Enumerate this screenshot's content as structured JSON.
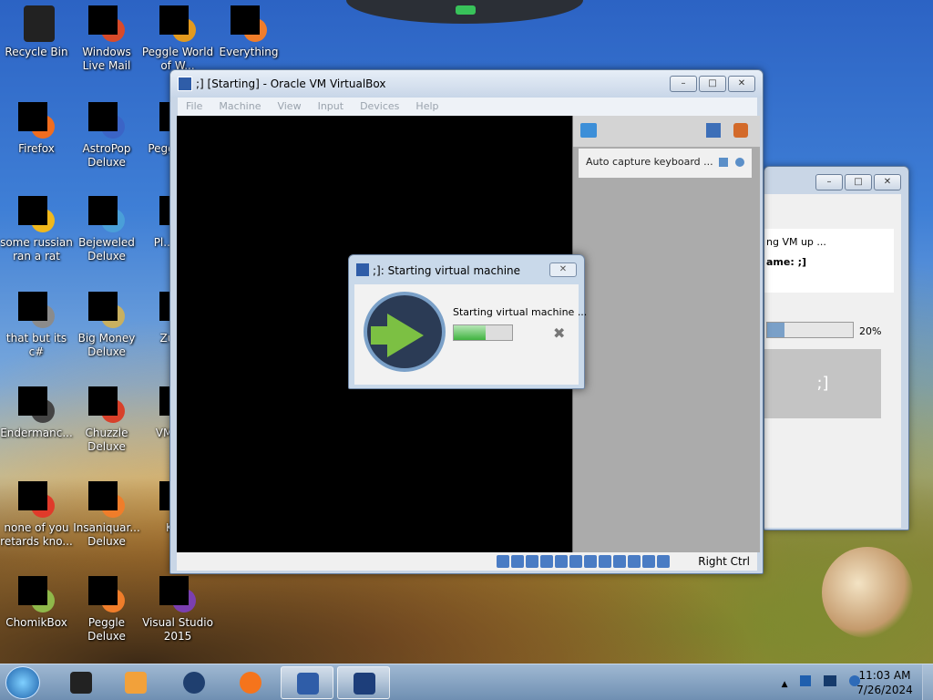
{
  "desktop_icons": [
    {
      "label": "Recycle Bin",
      "icon": "recycle-bin-icon"
    },
    {
      "label": "Windows Live Mail",
      "icon": "mail-icon"
    },
    {
      "label": "Peggle World of W...",
      "icon": "peggle-icon"
    },
    {
      "label": "Everything",
      "icon": "everything-icon"
    },
    {
      "label": "Firefox",
      "icon": "firefox-icon"
    },
    {
      "label": "AstroPop Deluxe",
      "icon": "game-icon"
    },
    {
      "label": "Pegg... D...",
      "icon": "game-icon"
    },
    {
      "label": "some russian ran a rat",
      "icon": "app-icon"
    },
    {
      "label": "Bejeweled Deluxe",
      "icon": "game-icon"
    },
    {
      "label": "Pl... Zo...",
      "icon": "game-icon"
    },
    {
      "label": "that but its c#",
      "icon": "app-icon"
    },
    {
      "label": "Big Money Deluxe",
      "icon": "game-icon"
    },
    {
      "label": "Zum...",
      "icon": "game-icon"
    },
    {
      "label": "Endermanc...",
      "icon": "app-icon"
    },
    {
      "label": "Chuzzle Deluxe",
      "icon": "game-icon"
    },
    {
      "label": "VM Ke...",
      "icon": "app-icon"
    },
    {
      "label": "none of you retards kno...",
      "icon": "app-icon"
    },
    {
      "label": "Insaniquar... Deluxe",
      "icon": "game-icon"
    },
    {
      "label": "Ke...",
      "icon": "app-icon"
    },
    {
      "label": "ChomikBox",
      "icon": "chomikbox-icon"
    },
    {
      "label": "Peggle Deluxe",
      "icon": "peggle-icon"
    },
    {
      "label": "Visual Studio 2015",
      "icon": "visual-studio-icon"
    }
  ],
  "vbox_window": {
    "title": ";] [Starting] - Oracle VM VirtualBox",
    "menu": [
      "File",
      "Machine",
      "View",
      "Input",
      "Devices",
      "Help"
    ],
    "notice": "Auto capture keyboard ...",
    "host_key": "Right Ctrl",
    "min": "–",
    "max": "□",
    "close": "✕"
  },
  "start_dialog": {
    "title": ";]: Starting virtual machine",
    "status": "Starting virtual machine ...",
    "progress": 0.55,
    "close": "✕",
    "cancel": "✖"
  },
  "back_window": {
    "status": "ng VM up ...",
    "name_label": "ame: ;]",
    "progress_text": "20%",
    "progress": 0.2,
    "preview": ";]",
    "min": "–",
    "max": "□",
    "close": "✕"
  },
  "taskbar": {
    "time": "11:03 AM",
    "date": "7/26/2024",
    "tray_arrow": "▲"
  }
}
